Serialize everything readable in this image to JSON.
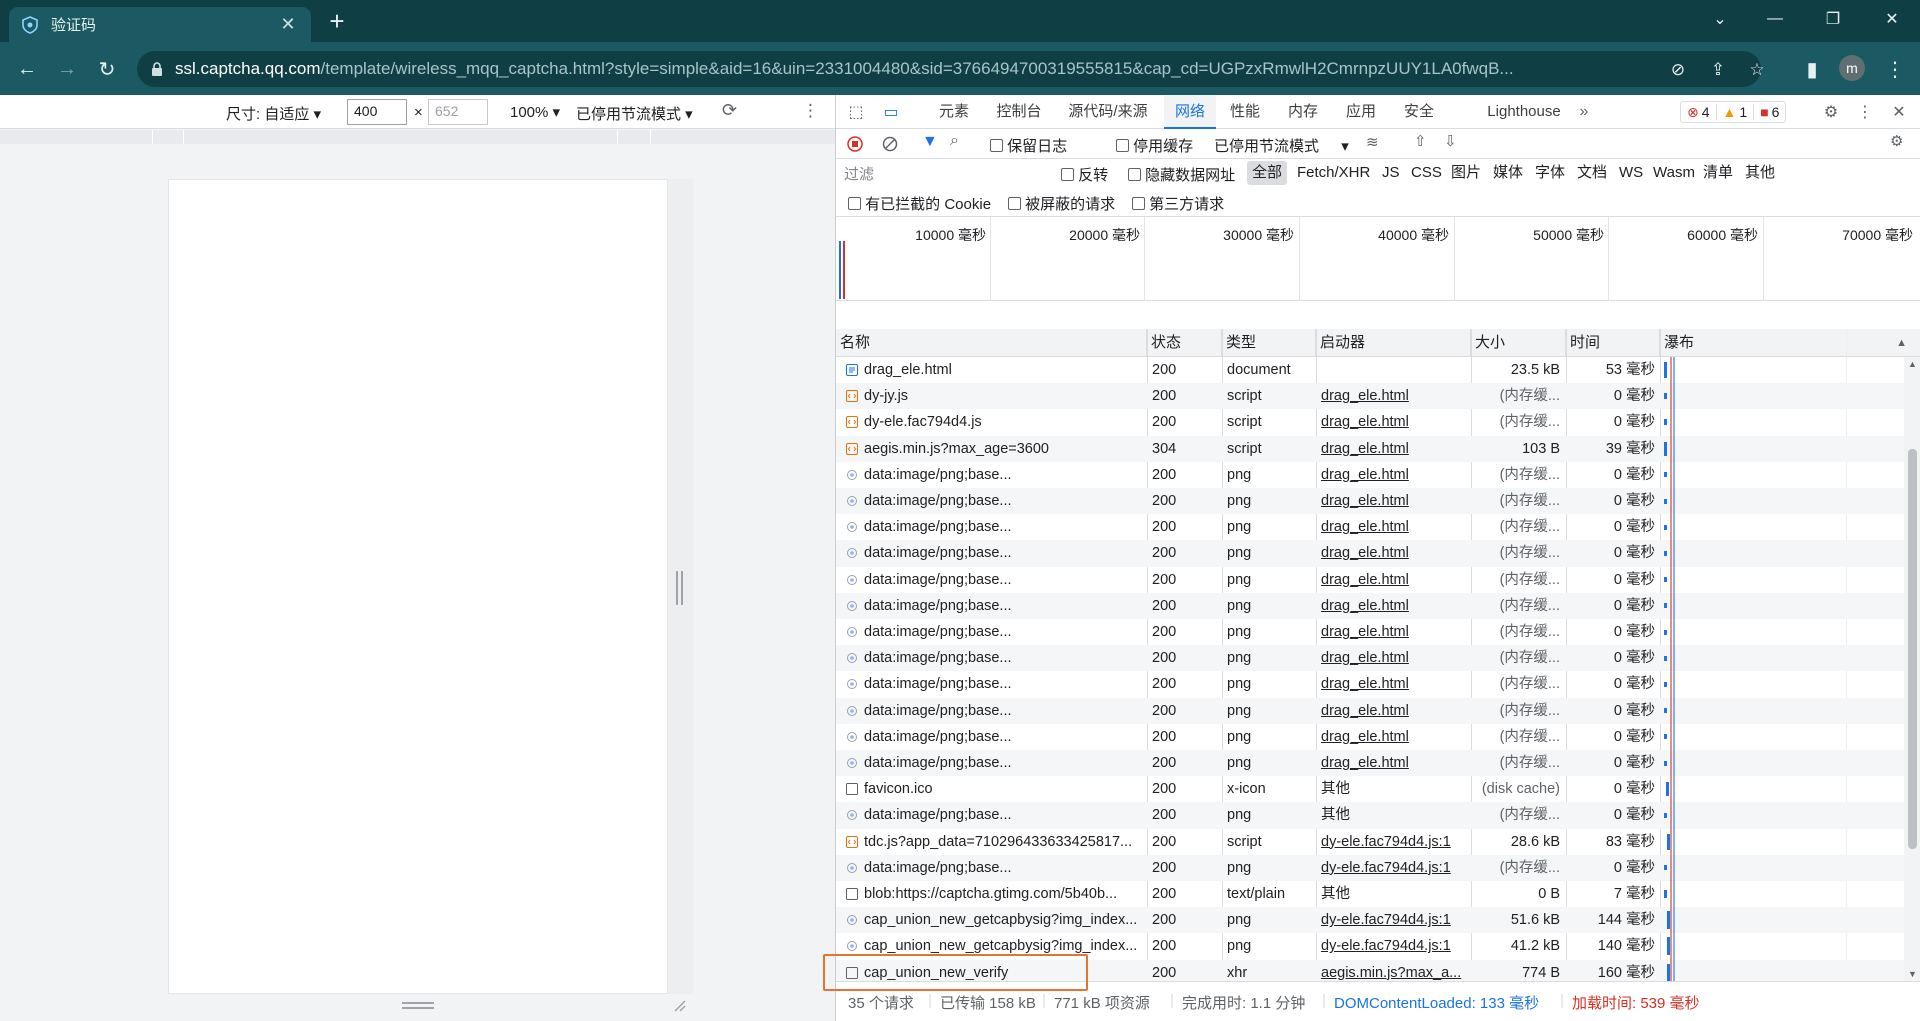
{
  "browser": {
    "tab_title": "验证码",
    "url_host": "ssl.captcha.qq.com",
    "url_path": "/template/wireless_mqq_captcha.html?style=simple&aid=16&uin=2331004480&sid=3766494700319555815&cap_cd=UGPzxRmwlH2CmrnpzUUY1LA0fwqB...",
    "avatar_letter": "m"
  },
  "device_toolbar": {
    "size_label": "尺寸: 自适应 ▾",
    "width": "400",
    "height_placeholder": "652",
    "zoom": "100% ▾",
    "throttle": "已停用节流模式 ▾"
  },
  "devtools": {
    "tabs": [
      "元素",
      "控制台",
      "源代码/来源",
      "网络",
      "性能",
      "内存",
      "应用",
      "安全",
      "Lighthouse"
    ],
    "active_tab": "网络",
    "errors": "4",
    "warnings": "1",
    "issues": "6",
    "toolbar": {
      "preserve_log": "保留日志",
      "disable_cache": "停用缓存",
      "throttle": "已停用节流模式"
    },
    "filter": {
      "placeholder": "过滤",
      "invert": "反转",
      "hide_data_urls": "隐藏数据网址",
      "types": [
        "全部",
        "Fetch/XHR",
        "JS",
        "CSS",
        "图片",
        "媒体",
        "字体",
        "文档",
        "WS",
        "Wasm",
        "清单",
        "其他"
      ],
      "active_type": "全部",
      "blocked_cookies": "有已拦截的 Cookie",
      "blocked_requests": "被屏蔽的请求",
      "third_party": "第三方请求"
    },
    "overview_ticks": [
      "10000 毫秒",
      "20000 毫秒",
      "30000 毫秒",
      "40000 毫秒",
      "50000 毫秒",
      "60000 毫秒",
      "70000 毫秒"
    ],
    "columns": [
      "名称",
      "状态",
      "类型",
      "启动器",
      "大小",
      "时间",
      "瀑布"
    ],
    "rows": [
      {
        "name": "drag_ele.html",
        "status": "200",
        "type": "document",
        "initiator": "",
        "size": "23.5 kB",
        "time": "53 毫秒",
        "icon": "document-icon"
      },
      {
        "name": "dy-jy.js",
        "status": "200",
        "type": "script",
        "initiator": "drag_ele.html",
        "size": "(内存缓...",
        "time": "0 毫秒",
        "icon": "script-icon"
      },
      {
        "name": "dy-ele.fac794d4.js",
        "status": "200",
        "type": "script",
        "initiator": "drag_ele.html",
        "size": "(内存缓...",
        "time": "0 毫秒",
        "icon": "script-icon"
      },
      {
        "name": "aegis.min.js?max_age=3600",
        "status": "304",
        "type": "script",
        "initiator": "drag_ele.html",
        "size": "103 B",
        "time": "39 毫秒",
        "icon": "script-icon"
      },
      {
        "name": "data:image/png;base...",
        "status": "200",
        "type": "png",
        "initiator": "drag_ele.html",
        "size": "(内存缓...",
        "time": "0 毫秒",
        "icon": "image-icon"
      },
      {
        "name": "data:image/png;base...",
        "status": "200",
        "type": "png",
        "initiator": "drag_ele.html",
        "size": "(内存缓...",
        "time": "0 毫秒",
        "icon": "image-icon"
      },
      {
        "name": "data:image/png;base...",
        "status": "200",
        "type": "png",
        "initiator": "drag_ele.html",
        "size": "(内存缓...",
        "time": "0 毫秒",
        "icon": "image-icon"
      },
      {
        "name": "data:image/png;base...",
        "status": "200",
        "type": "png",
        "initiator": "drag_ele.html",
        "size": "(内存缓...",
        "time": "0 毫秒",
        "icon": "image-icon"
      },
      {
        "name": "data:image/png;base...",
        "status": "200",
        "type": "png",
        "initiator": "drag_ele.html",
        "size": "(内存缓...",
        "time": "0 毫秒",
        "icon": "image-icon"
      },
      {
        "name": "data:image/png;base...",
        "status": "200",
        "type": "png",
        "initiator": "drag_ele.html",
        "size": "(内存缓...",
        "time": "0 毫秒",
        "icon": "image-icon"
      },
      {
        "name": "data:image/png;base...",
        "status": "200",
        "type": "png",
        "initiator": "drag_ele.html",
        "size": "(内存缓...",
        "time": "0 毫秒",
        "icon": "image-icon"
      },
      {
        "name": "data:image/png;base...",
        "status": "200",
        "type": "png",
        "initiator": "drag_ele.html",
        "size": "(内存缓...",
        "time": "0 毫秒",
        "icon": "image-icon"
      },
      {
        "name": "data:image/png;base...",
        "status": "200",
        "type": "png",
        "initiator": "drag_ele.html",
        "size": "(内存缓...",
        "time": "0 毫秒",
        "icon": "image-icon"
      },
      {
        "name": "data:image/png;base...",
        "status": "200",
        "type": "png",
        "initiator": "drag_ele.html",
        "size": "(内存缓...",
        "time": "0 毫秒",
        "icon": "image-icon"
      },
      {
        "name": "data:image/png;base...",
        "status": "200",
        "type": "png",
        "initiator": "drag_ele.html",
        "size": "(内存缓...",
        "time": "0 毫秒",
        "icon": "image-icon"
      },
      {
        "name": "data:image/png;base...",
        "status": "200",
        "type": "png",
        "initiator": "drag_ele.html",
        "size": "(内存缓...",
        "time": "0 毫秒",
        "icon": "image-icon"
      },
      {
        "name": "favicon.ico",
        "status": "200",
        "type": "x-icon",
        "initiator": "其他",
        "size": "(disk cache)",
        "time": "0 毫秒",
        "icon": "blank-icon"
      },
      {
        "name": "data:image/png;base...",
        "status": "200",
        "type": "png",
        "initiator": "其他",
        "size": "(内存缓...",
        "time": "0 毫秒",
        "icon": "image-icon"
      },
      {
        "name": "tdc.js?app_data=710296433633425817...",
        "status": "200",
        "type": "script",
        "initiator": "dy-ele.fac794d4.js:1",
        "size": "28.6 kB",
        "time": "83 毫秒",
        "icon": "script-icon"
      },
      {
        "name": "data:image/png;base...",
        "status": "200",
        "type": "png",
        "initiator": "dy-ele.fac794d4.js:1",
        "size": "(内存缓...",
        "time": "0 毫秒",
        "icon": "image-icon"
      },
      {
        "name": "blob:https://captcha.gtimg.com/5b40b...",
        "status": "200",
        "type": "text/plain",
        "initiator": "其他",
        "size": "0 B",
        "time": "7 毫秒",
        "icon": "blank-icon"
      },
      {
        "name": "cap_union_new_getcapbysig?img_index...",
        "status": "200",
        "type": "png",
        "initiator": "dy-ele.fac794d4.js:1",
        "size": "51.6 kB",
        "time": "144 毫秒",
        "icon": "image-icon"
      },
      {
        "name": "cap_union_new_getcapbysig?img_index...",
        "status": "200",
        "type": "png",
        "initiator": "dy-ele.fac794d4.js:1",
        "size": "41.2 kB",
        "time": "140 毫秒",
        "icon": "image-icon"
      },
      {
        "name": "cap_union_new_verify",
        "status": "200",
        "type": "xhr",
        "initiator": "aegis.min.js?max_a...",
        "size": "774 B",
        "time": "160 毫秒",
        "icon": "blank-icon"
      }
    ],
    "status_bar": {
      "requests": "35 个请求",
      "transferred": "已传输 158 kB",
      "resources": "771 kB 项资源",
      "finish": "完成用时: 1.1 分钟",
      "dom_loaded": "DOMContentLoaded: 133 毫秒",
      "load": "加载时间: 539 毫秒"
    },
    "colors": {
      "accent": "#1a73e8",
      "error": "#d93025",
      "warning": "#f29900",
      "highlight_box": "#e8732e"
    }
  }
}
